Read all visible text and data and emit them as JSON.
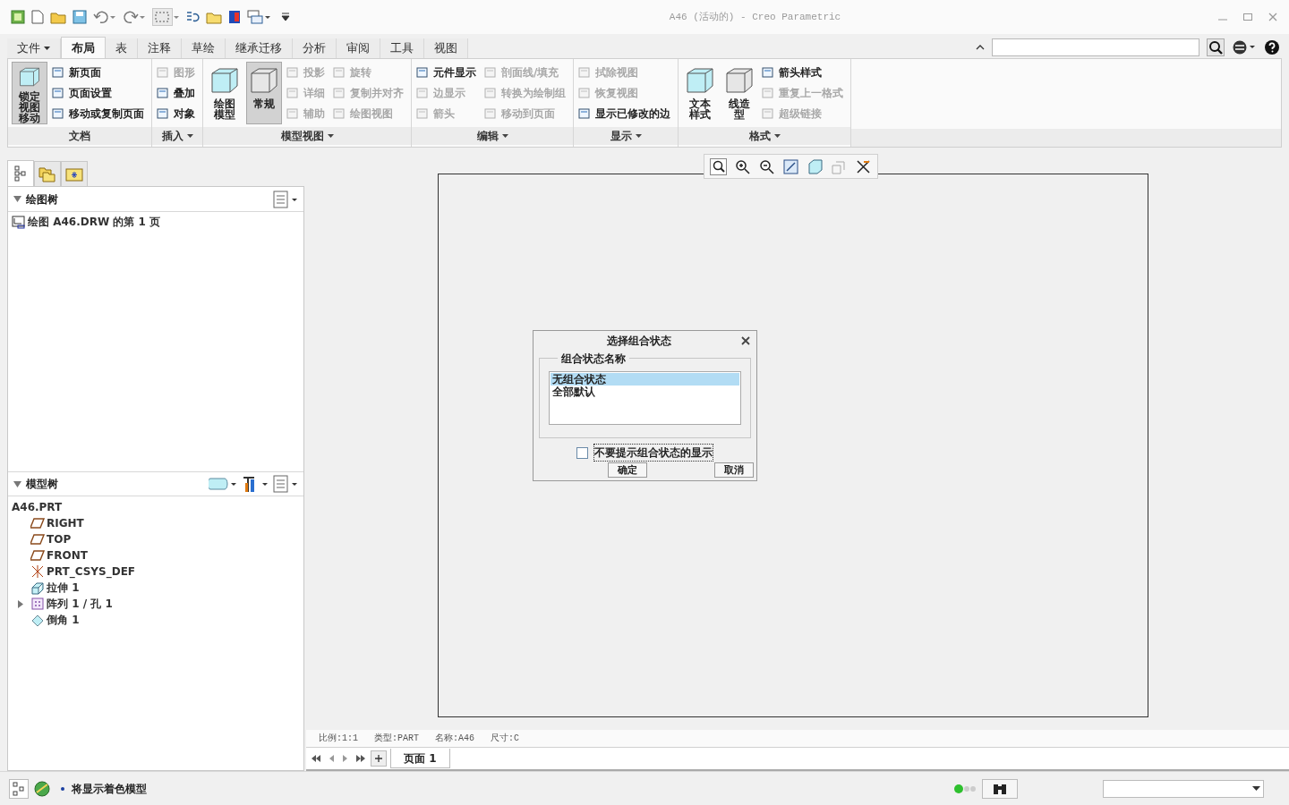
{
  "window": {
    "title": "A46 (活动的) - Creo Parametric"
  },
  "ribbon": {
    "tabs": [
      {
        "label": "文件",
        "kind": "menu",
        "selected": false
      },
      {
        "label": "布局",
        "kind": "tab",
        "selected": true
      },
      {
        "label": "表",
        "kind": "tab",
        "selected": false
      },
      {
        "label": "注释",
        "kind": "tab",
        "selected": false
      },
      {
        "label": "草绘",
        "kind": "tab",
        "selected": false
      },
      {
        "label": "继承迁移",
        "kind": "tab",
        "selected": false
      },
      {
        "label": "分析",
        "kind": "tab",
        "selected": false
      },
      {
        "label": "审阅",
        "kind": "tab",
        "selected": false
      },
      {
        "label": "工具",
        "kind": "tab",
        "selected": false
      },
      {
        "label": "视图",
        "kind": "tab",
        "selected": false
      }
    ],
    "groups": [
      {
        "label": "文档",
        "has_menu": false,
        "items": [
          {
            "label": "锁定视图移动",
            "kind": "large",
            "pressed": true,
            "disabled": false
          },
          {
            "label": "新页面",
            "kind": "small",
            "disabled": false
          },
          {
            "label": "页面设置",
            "kind": "small",
            "disabled": false
          },
          {
            "label": "移动或复制页面",
            "kind": "small",
            "disabled": false
          }
        ]
      },
      {
        "label": "插入",
        "has_menu": true,
        "items": [
          {
            "label": "图形",
            "kind": "small",
            "disabled": true
          },
          {
            "label": "叠加",
            "kind": "small",
            "disabled": false
          },
          {
            "label": "对象",
            "kind": "small",
            "disabled": false
          }
        ]
      },
      {
        "label": "模型视图",
        "has_menu": true,
        "items": [
          {
            "label": "绘图模型",
            "kind": "large",
            "pressed": false,
            "disabled": false
          },
          {
            "label": "常规",
            "kind": "large",
            "pressed": true,
            "disabled": false
          },
          {
            "label": "投影",
            "kind": "small",
            "disabled": true
          },
          {
            "label": "详细",
            "kind": "small",
            "disabled": true
          },
          {
            "label": "辅助",
            "kind": "small",
            "disabled": true
          },
          {
            "label": "旋转",
            "kind": "small",
            "disabled": true
          },
          {
            "label": "复制并对齐",
            "kind": "small",
            "disabled": true
          },
          {
            "label": "绘图视图",
            "kind": "small",
            "disabled": true
          }
        ]
      },
      {
        "label": "编辑",
        "has_menu": true,
        "items": [
          {
            "label": "元件显示",
            "kind": "small",
            "disabled": false
          },
          {
            "label": "边显示",
            "kind": "small",
            "disabled": true
          },
          {
            "label": "箭头",
            "kind": "small",
            "disabled": true
          },
          {
            "label": "剖面线/填充",
            "kind": "small",
            "disabled": true
          },
          {
            "label": "转换为绘制组",
            "kind": "small",
            "disabled": true
          },
          {
            "label": "移动到页面",
            "kind": "small",
            "disabled": true
          }
        ]
      },
      {
        "label": "显示",
        "has_menu": true,
        "items": [
          {
            "label": "拭除视图",
            "kind": "small",
            "disabled": true
          },
          {
            "label": "恢复视图",
            "kind": "small",
            "disabled": true
          },
          {
            "label": "显示已修改的边",
            "kind": "small",
            "disabled": false
          }
        ]
      },
      {
        "label": "格式",
        "has_menu": true,
        "items": [
          {
            "label": "文本样式",
            "kind": "large",
            "pressed": false,
            "disabled": false
          },
          {
            "label": "线造型",
            "kind": "large",
            "pressed": false,
            "disabled": false
          },
          {
            "label": "箭头样式",
            "kind": "small",
            "disabled": false
          },
          {
            "label": "重复上一格式",
            "kind": "small",
            "disabled": true
          },
          {
            "label": "超级链接",
            "kind": "small",
            "disabled": true
          }
        ]
      }
    ]
  },
  "navigator_tabs": [
    {
      "selected": true
    },
    {
      "selected": false
    },
    {
      "selected": false
    }
  ],
  "drawing_tree": {
    "title": "绘图树",
    "items": [
      "绘图 A46.DRW 的第 1 页"
    ]
  },
  "model_tree": {
    "title": "模型树",
    "root": "A46.PRT",
    "items": [
      {
        "label": "RIGHT",
        "kind": "plane"
      },
      {
        "label": "TOP",
        "kind": "plane"
      },
      {
        "label": "FRONT",
        "kind": "plane"
      },
      {
        "label": "PRT_CSYS_DEF",
        "kind": "csys"
      },
      {
        "label": "拉伸 1",
        "kind": "extrude"
      },
      {
        "label": "阵列 1 / 孔 1",
        "kind": "pattern",
        "expanded": false
      },
      {
        "label": "倒角 1",
        "kind": "chamfer"
      }
    ]
  },
  "drawing": {
    "info": [
      "比例:1:1",
      "类型:PART",
      "名称:A46",
      "尺寸:C"
    ],
    "pages": [
      {
        "label": "页面 1",
        "selected": true
      }
    ]
  },
  "dialog": {
    "title": "选择组合状态",
    "group_label": "组合状态名称",
    "options": [
      {
        "label": "无组合状态",
        "selected": true
      },
      {
        "label": "全部默认",
        "selected": false
      }
    ],
    "checkbox": {
      "label": "不要提示组合状态的显示",
      "checked": false
    },
    "buttons": [
      "确定",
      "取消"
    ]
  },
  "status_bar": {
    "message": "将显示着色模型"
  }
}
